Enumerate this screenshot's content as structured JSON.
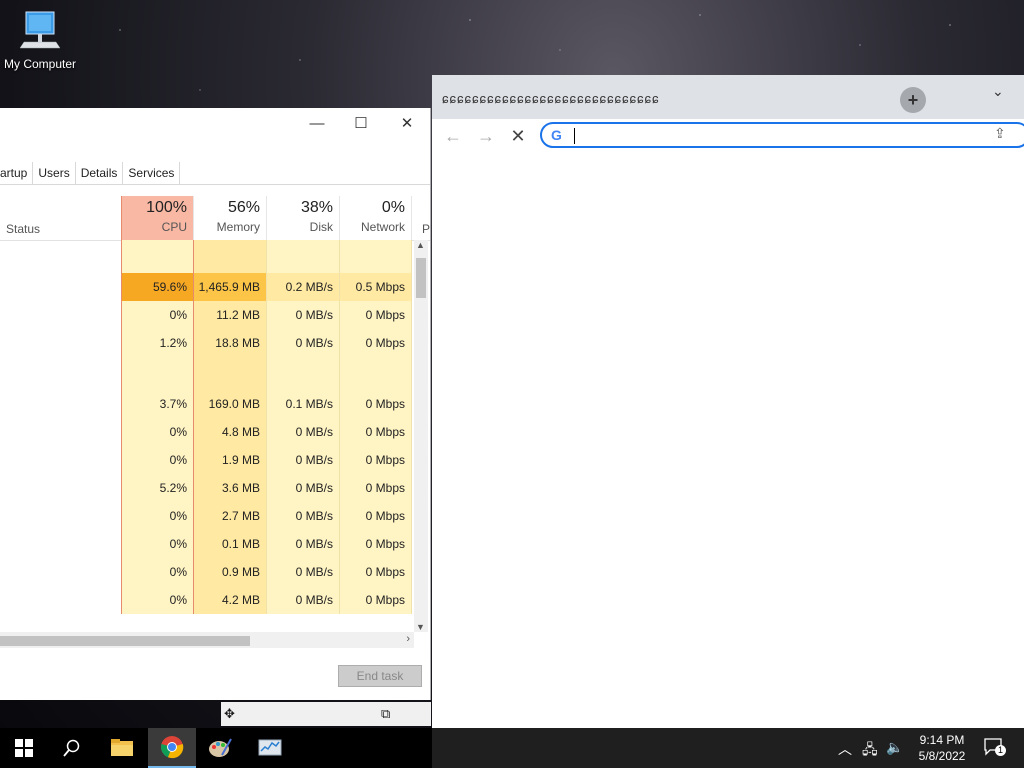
{
  "desktop": {
    "icon_label": "My Computer"
  },
  "task_manager": {
    "window_controls": {
      "minimize": "—",
      "maximize": "☐",
      "close": "✕"
    },
    "tabs": [
      "artup",
      "Users",
      "Details",
      "Services"
    ],
    "columns": {
      "status": "Status",
      "cpu": {
        "pct": "100%",
        "name": "CPU"
      },
      "memory": {
        "pct": "56%",
        "name": "Memory"
      },
      "disk": {
        "pct": "38%",
        "name": "Disk"
      },
      "network": {
        "pct": "0%",
        "name": "Network"
      },
      "next": "P"
    },
    "rows": [
      {
        "group": true,
        "cpu": "",
        "memory": "",
        "disk": "",
        "network": ""
      },
      {
        "cpu": "59.6%",
        "memory": "1,465.9 MB",
        "disk": "0.2 MB/s",
        "network": "0.5 Mbps",
        "hot": true
      },
      {
        "cpu": "0%",
        "memory": "11.2 MB",
        "disk": "0 MB/s",
        "network": "0 Mbps"
      },
      {
        "cpu": "1.2%",
        "memory": "18.8 MB",
        "disk": "0 MB/s",
        "network": "0 Mbps"
      },
      {
        "group": true,
        "cpu": "",
        "memory": "",
        "disk": "",
        "network": ""
      },
      {
        "cpu": "3.7%",
        "memory": "169.0 MB",
        "disk": "0.1 MB/s",
        "network": "0 Mbps"
      },
      {
        "cpu": "0%",
        "memory": "4.8 MB",
        "disk": "0 MB/s",
        "network": "0 Mbps"
      },
      {
        "cpu": "0%",
        "memory": "1.9 MB",
        "disk": "0 MB/s",
        "network": "0 Mbps"
      },
      {
        "cpu": "5.2%",
        "memory": "3.6 MB",
        "disk": "0 MB/s",
        "network": "0 Mbps"
      },
      {
        "cpu": "0%",
        "memory": "2.7 MB",
        "disk": "0 MB/s",
        "network": "0 Mbps"
      },
      {
        "cpu": "0%",
        "memory": "0.1 MB",
        "disk": "0 MB/s",
        "network": "0 Mbps"
      },
      {
        "cpu": "0%",
        "memory": "0.9 MB",
        "disk": "0 MB/s",
        "network": "0 Mbps"
      },
      {
        "cpu": "0%",
        "memory": "4.2 MB",
        "disk": "0 MB/s",
        "network": "0 Mbps"
      }
    ],
    "end_task": "End task"
  },
  "chrome": {
    "tabs_glyphs": "ɕɕɕɕɕɕɕɕɕɕɕɕɕɕɕɕɕɕɕɕɕɕɕɕɕɕɕɕɕ",
    "new_tab": "+",
    "omnibox_value": "",
    "google_g": "G"
  },
  "taskbar": {
    "time": "9:14 PM",
    "date": "5/8/2022",
    "notification_count": "1"
  },
  "colors": {
    "cpu_header": "#f9b8a4",
    "hot_cell": "#f7a823",
    "heat_light": "#fff4c4",
    "heat_mid": "#ffe9a3",
    "omnibox_border": "#1a73e8",
    "taskbar": "#1f1f1f"
  }
}
